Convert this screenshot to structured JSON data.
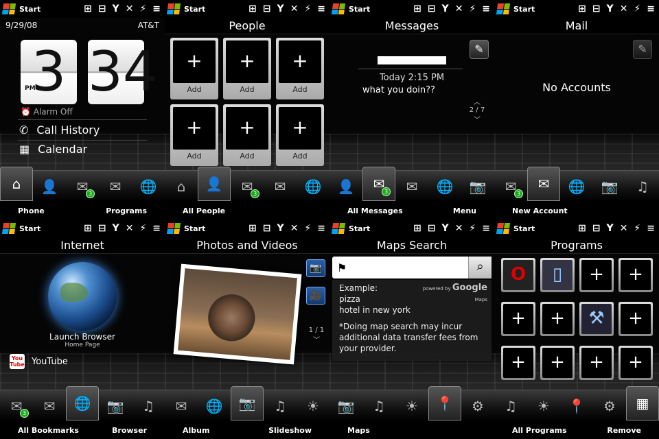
{
  "status_start": "Start",
  "status_icons": [
    "⊞",
    "⊟",
    "Y",
    "✕",
    "⚡",
    "≡"
  ],
  "panels": {
    "home": {
      "date": "9/29/08",
      "carrier": "AT&T",
      "hour": "3",
      "minute": "34",
      "ampm": "PM",
      "alarm": "Alarm Off",
      "call_history": "Call History",
      "calendar": "Calendar",
      "soft_left": "Phone",
      "soft_right": "Programs"
    },
    "people": {
      "title": "People",
      "add_label": "Add",
      "soft_left": "All People",
      "soft_right": ""
    },
    "messages": {
      "title": "Messages",
      "time": "Today 2:15 PM",
      "text": "what you doin??",
      "pager": "2 / 7",
      "soft_left": "All Messages",
      "soft_right": "Menu"
    },
    "mail": {
      "title": "Mail",
      "no_accounts": "No Accounts",
      "soft_left": "New Account",
      "soft_right": ""
    },
    "internet": {
      "title": "Internet",
      "launch": "Launch Browser",
      "home_page": "Home Page",
      "youtube": "YouTube",
      "soft_left": "All Bookmarks",
      "soft_right": "Browser"
    },
    "photos": {
      "title": "Photos and Videos",
      "pager": "1 / 1",
      "soft_left": "Album",
      "soft_right": "Slideshow"
    },
    "maps": {
      "title": "Maps Search",
      "search_value": "",
      "powered": "powered by",
      "brand": "Google",
      "brand_sub": "Maps",
      "example_label": "Example:",
      "example1": "pizza",
      "example2": "hotel in new york",
      "note": "*Doing map search may incur additional data transfer fees from your provider.",
      "soft_left": "Maps",
      "soft_right": ""
    },
    "programs": {
      "title": "Programs",
      "soft_left": "All Programs",
      "soft_right": "Remove"
    }
  },
  "badge_count": "3",
  "colors": {
    "badge": "#1eab1e",
    "accent_blue": "#2a5fa8"
  }
}
